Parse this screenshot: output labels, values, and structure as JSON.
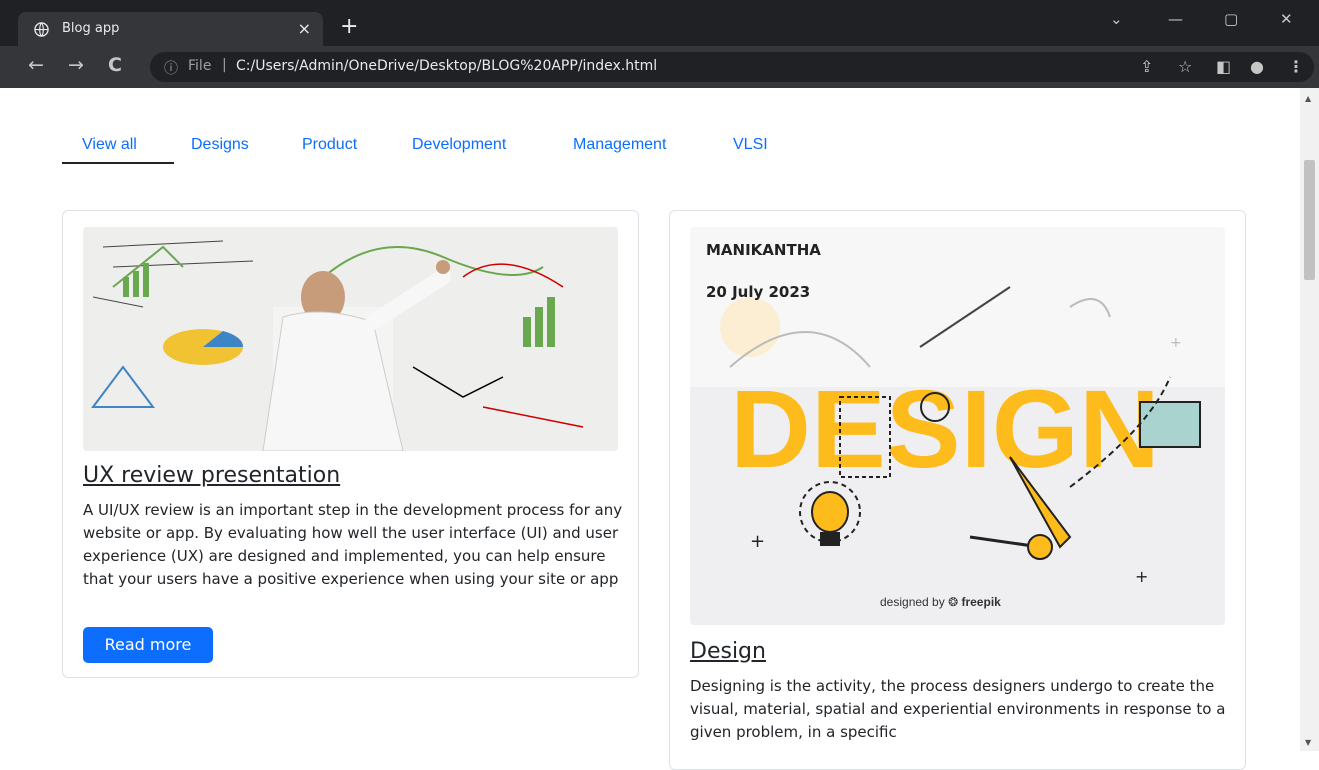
{
  "browser": {
    "tab_title": "Blog app",
    "tab_close": "×",
    "new_tab": "+",
    "scheme": "File",
    "separator": "|",
    "url": "C:/Users/Admin/OneDrive/Desktop/BLOG%20APP/index.html"
  },
  "categories": [
    {
      "label": "View all",
      "active": true
    },
    {
      "label": "Designs"
    },
    {
      "label": "Product"
    },
    {
      "label": "Development"
    },
    {
      "label": "Management"
    },
    {
      "label": "VLSI"
    }
  ],
  "cards": [
    {
      "title": "UX review presentation",
      "text": "A UI/UX review is an important step in the development process for any website or app. By evaluating how well the user interface (UI) and user experience (UX) are designed and implemented, you can help ensure that your users have a positive experience when using your site or app",
      "button": "Read more",
      "image_icon": "whiteboard-presentation-image"
    },
    {
      "author": "MANIKANTHA",
      "date": "20 July 2023",
      "image_word": "DESIGN",
      "credit": "designed by",
      "credit_brand": "freepik",
      "title": "Design",
      "text": "Designing is the activity, the process designers undergo to create the visual, material, spatial and experiential environments in response to a given problem, in a specific"
    }
  ],
  "colors": {
    "link": "#0d6efd",
    "button": "#0d6efd",
    "design_yellow": "#fdbb1c"
  }
}
